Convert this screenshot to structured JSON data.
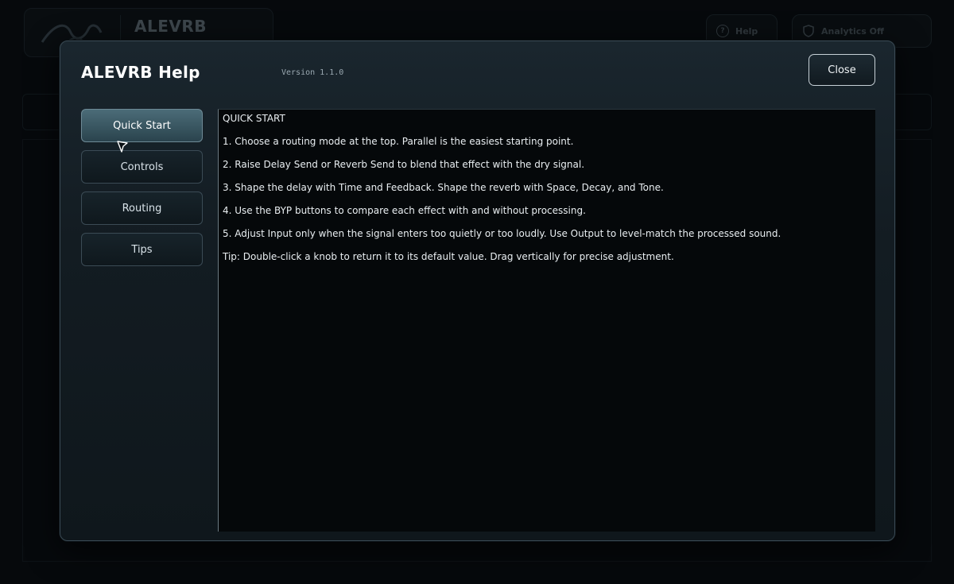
{
  "background": {
    "app_title": "ALEVRB",
    "help_label": "Help",
    "analytics_label": "Analytics Off"
  },
  "modal": {
    "title": "ALEVRB Help",
    "version": "Version 1.1.0",
    "close_label": "Close",
    "nav": [
      {
        "label": "Quick Start",
        "active": true
      },
      {
        "label": "Controls",
        "active": false
      },
      {
        "label": "Routing",
        "active": false
      },
      {
        "label": "Tips",
        "active": false
      }
    ],
    "content": {
      "heading": "QUICK START",
      "lines": [
        "1. Choose a routing mode at the top. Parallel is the easiest starting point.",
        "2. Raise Delay Send or Reverb Send to blend that effect with the dry signal.",
        "3. Shape the delay with Time and Feedback. Shape the reverb with Space, Decay, and Tone.",
        "4. Use the BYP buttons to compare each effect with and without processing.",
        "5. Adjust Input only when the signal enters too quietly or too loudly. Use Output to level-match the processed sound.",
        "Tip: Double-click a knob to return it to its default value. Drag vertically for precise adjustment."
      ]
    }
  },
  "colors": {
    "accent_active": "#4b6c78",
    "modal_border": "#3a4a54",
    "content_bg": "#05080a"
  },
  "icons": {
    "help": "question-circle-icon",
    "analytics": "shield-icon",
    "cursor": "mouse-pointer-icon"
  }
}
